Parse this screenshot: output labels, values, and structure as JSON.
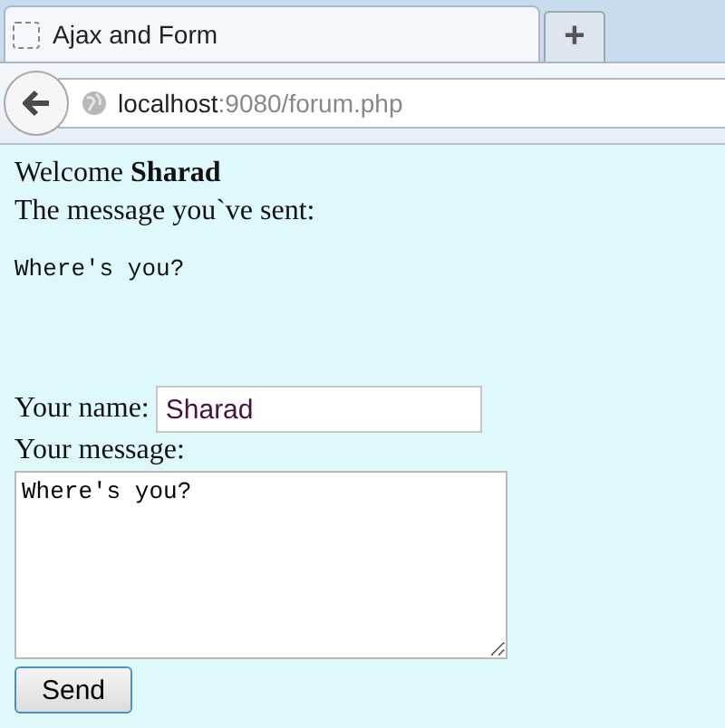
{
  "browser": {
    "tab": {
      "title": "Ajax and Form",
      "selected": true
    },
    "new_tab": "+",
    "url": {
      "host": "localhost",
      "path": ":9080/forum.php"
    }
  },
  "page": {
    "welcome": "Welcome **Sharad**",
    "sent_label": "The message you`ve sent:",
    "sent_message": "Where's you?",
    "name_label": "Your name:",
    "name_value": "Sharad",
    "message_label": "Your message:",
    "message_value": "Where's you?",
    "submit": "Send"
  }
}
